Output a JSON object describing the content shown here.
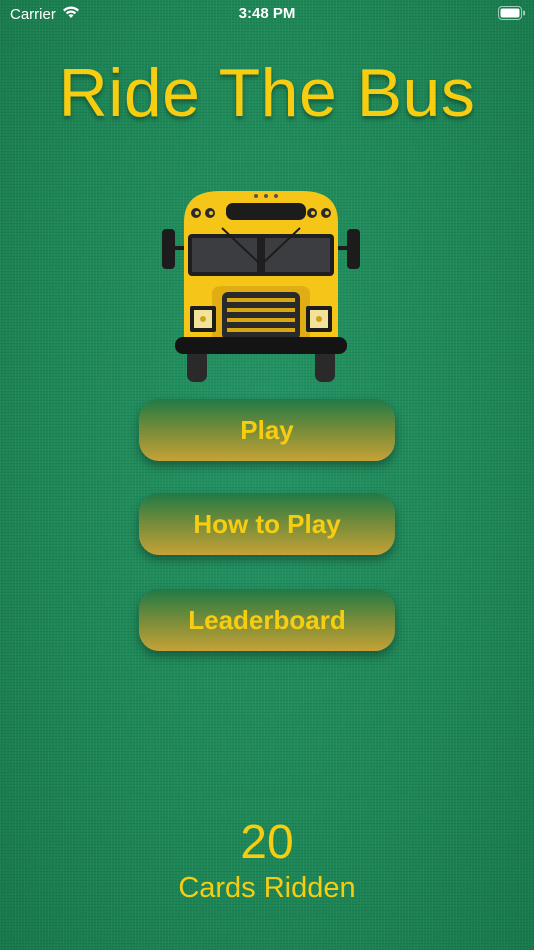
{
  "status_bar": {
    "carrier": "Carrier",
    "time": "3:48 PM",
    "wifi_icon": "wifi-icon",
    "battery_icon": "battery-icon"
  },
  "title": "Ride The Bus",
  "logo": "school-bus-icon",
  "menu": {
    "play": "Play",
    "how_to_play": "How to Play",
    "leaderboard": "Leaderboard"
  },
  "stats": {
    "count": "20",
    "label": "Cards Ridden"
  },
  "colors": {
    "background": "#1f8a5a",
    "accent": "#f7cd12",
    "bus_yellow": "#f5c518"
  }
}
